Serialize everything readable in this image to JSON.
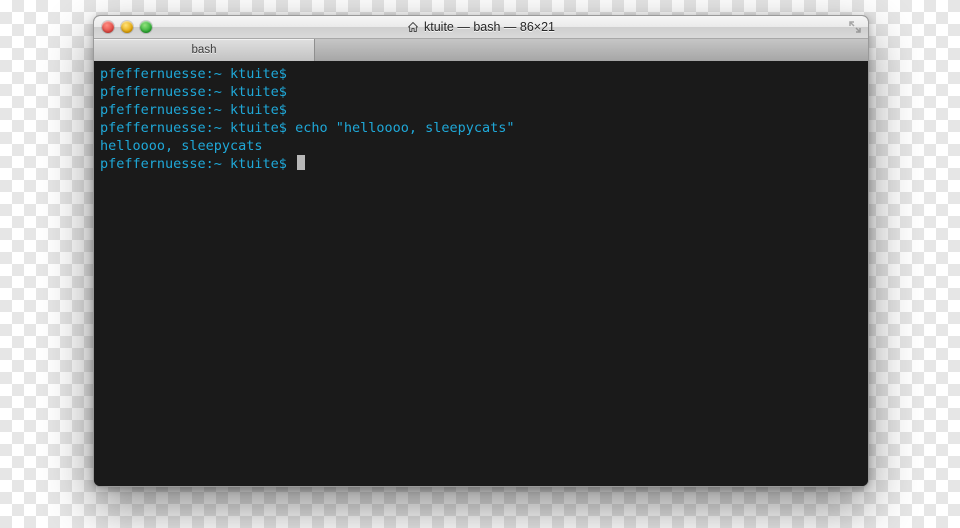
{
  "window": {
    "title": "ktuite — bash — 86×21"
  },
  "tabs": [
    {
      "label": "bash"
    }
  ],
  "terminal": {
    "prompt": "pfeffernuesse:~ ktuite$",
    "lines": [
      {
        "type": "prompt",
        "prompt": "pfeffernuesse:~ ktuite$",
        "command": ""
      },
      {
        "type": "prompt",
        "prompt": "pfeffernuesse:~ ktuite$",
        "command": ""
      },
      {
        "type": "prompt",
        "prompt": "pfeffernuesse:~ ktuite$",
        "command": ""
      },
      {
        "type": "prompt",
        "prompt": "pfeffernuesse:~ ktuite$",
        "command": "echo \"helloooo, sleepycats\""
      },
      {
        "type": "output",
        "text": "helloooo, sleepycats"
      },
      {
        "type": "prompt",
        "prompt": "pfeffernuesse:~ ktuite$",
        "command": "",
        "cursor": true
      }
    ]
  },
  "colors": {
    "terminal_bg": "#1a1a1a",
    "terminal_fg": "#1fa8d8"
  }
}
